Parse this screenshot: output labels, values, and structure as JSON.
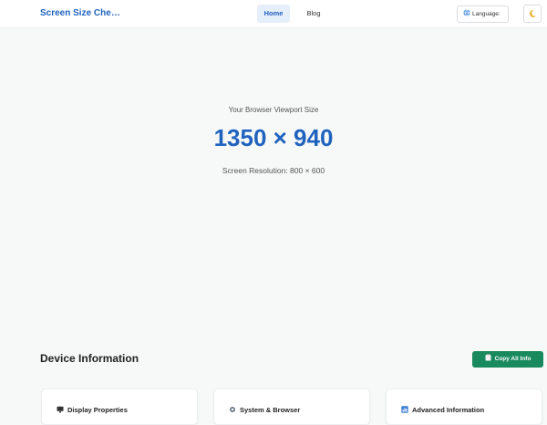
{
  "navbar": {
    "brand": "Screen Size Che…",
    "links": [
      {
        "label": "Home",
        "active": true
      },
      {
        "label": "Blog",
        "active": false
      }
    ],
    "language_label": "Language:",
    "theme_icon": "moon-icon"
  },
  "hero": {
    "label": "Your Browser Viewport Size",
    "value": "1350 × 940",
    "screen_resolution": "Screen Resolution: 800 × 600"
  },
  "device_section": {
    "title": "Device Information",
    "copy_button": "Copy All Info",
    "cards": [
      {
        "title": "Display Properties",
        "icon": "monitor-icon"
      },
      {
        "title": "System & Browser",
        "icon": "gear-icon"
      },
      {
        "title": "Advanced Information",
        "icon": "chart-icon"
      }
    ]
  },
  "colors": {
    "accent": "#1f63bf",
    "success": "#198a5e",
    "background": "#f7f8f8"
  }
}
